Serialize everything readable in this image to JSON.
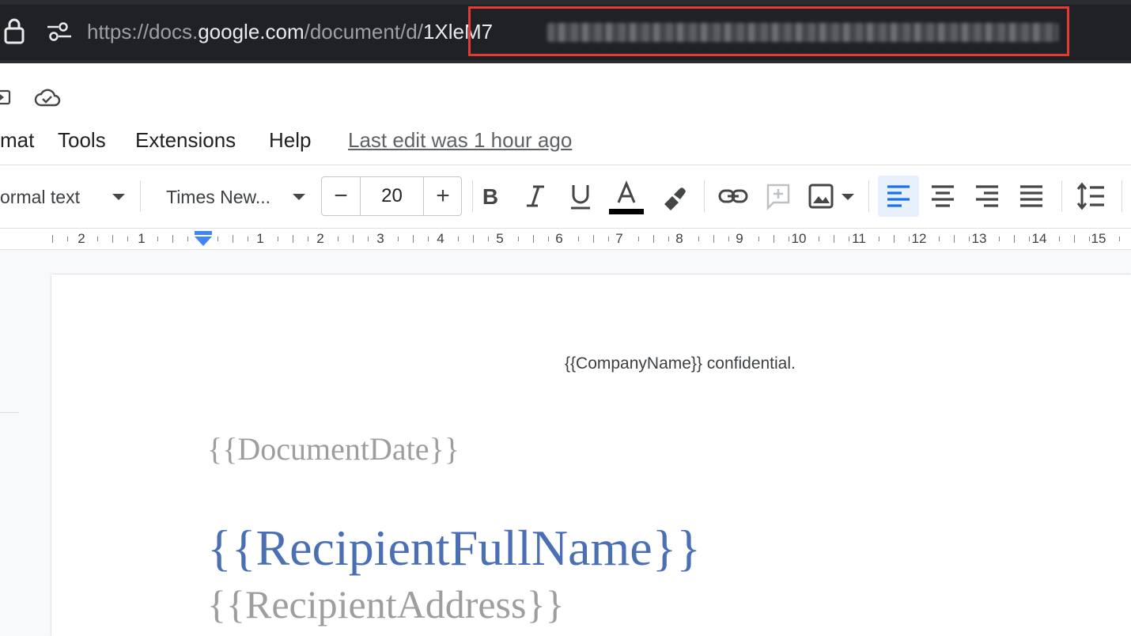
{
  "browser": {
    "url_scheme": "https://",
    "url_sub": "docs.",
    "url_domain": "google.com",
    "url_path": "/document/d/",
    "url_id_visible": "1XleM7",
    "highlight_color": "#e53935"
  },
  "menu": {
    "items": [
      "mat",
      "Tools",
      "Extensions",
      "Help"
    ],
    "last_edit": "Last edit was 1 hour ago"
  },
  "toolbar": {
    "style": "ormal text",
    "font": "Times New...",
    "font_size": "20",
    "minus": "−",
    "plus": "+",
    "text_color": "#000000",
    "active_align_bg": "#e8f0fe",
    "align_color": "#1a73e8"
  },
  "ruler": {
    "numbers": [
      "2",
      "1",
      "1",
      "2",
      "3",
      "4",
      "5",
      "6",
      "7",
      "8",
      "9",
      "10",
      "11",
      "12",
      "13",
      "14",
      "15"
    ]
  },
  "document": {
    "header": "{{CompanyName}} confidential.",
    "date": "{{DocumentDate}}",
    "recipient_name": "{{RecipientFullName}}",
    "recipient_address": "{{RecipientAddress}}",
    "accent_color": "#4a6fb5"
  }
}
